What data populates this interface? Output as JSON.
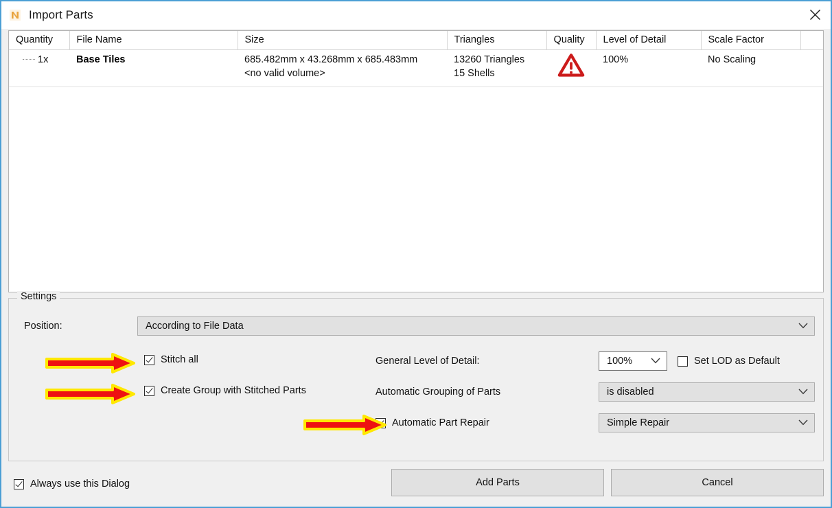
{
  "window": {
    "title": "Import Parts",
    "app_icon": "netfabb-n-icon",
    "close_icon": "close-icon",
    "accent_border": "#4b9fd5",
    "logo_color": "#e8a33d"
  },
  "table": {
    "headers": [
      "Quantity",
      "File Name",
      "Size",
      "Triangles",
      "Quality",
      "Level of Detail",
      "Scale Factor"
    ],
    "rows": [
      {
        "quantity": "1x",
        "file_name": "Base Tiles",
        "size_line1": "685.482mm x 43.268mm x 685.483mm",
        "size_line2": "<no valid volume>",
        "triangles_line1": "13260 Triangles",
        "triangles_line2": "15 Shells",
        "quality_icon": "warning-triangle-icon",
        "level_of_detail": "100%",
        "scale_factor": "No Scaling"
      }
    ]
  },
  "settings": {
    "legend": "Settings",
    "position_label": "Position:",
    "position_value": "According to File Data",
    "stitch_all_label": "Stitch all",
    "stitch_all_checked": true,
    "create_group_label": "Create Group with Stitched Parts",
    "create_group_checked": true,
    "general_lod_label": "General Level of Detail:",
    "general_lod_value": "100%",
    "set_lod_default_label": "Set LOD as Default",
    "set_lod_default_checked": false,
    "auto_group_label": "Automatic Grouping of Parts",
    "auto_group_value": "is disabled",
    "auto_repair_label": "Automatic Part Repair",
    "auto_repair_checked": true,
    "auto_repair_value": "Simple Repair"
  },
  "footer": {
    "always_use_label": "Always use this Dialog",
    "always_use_checked": true,
    "add_parts_label": "Add Parts",
    "cancel_label": "Cancel"
  },
  "annotations": {
    "arrow_color": "#ee1111",
    "arrow_outline_color": "#ffe800",
    "arrows": [
      {
        "target": "stitch-all-checkbox"
      },
      {
        "target": "create-group-checkbox"
      },
      {
        "target": "automatic-part-repair-checkbox"
      }
    ]
  }
}
